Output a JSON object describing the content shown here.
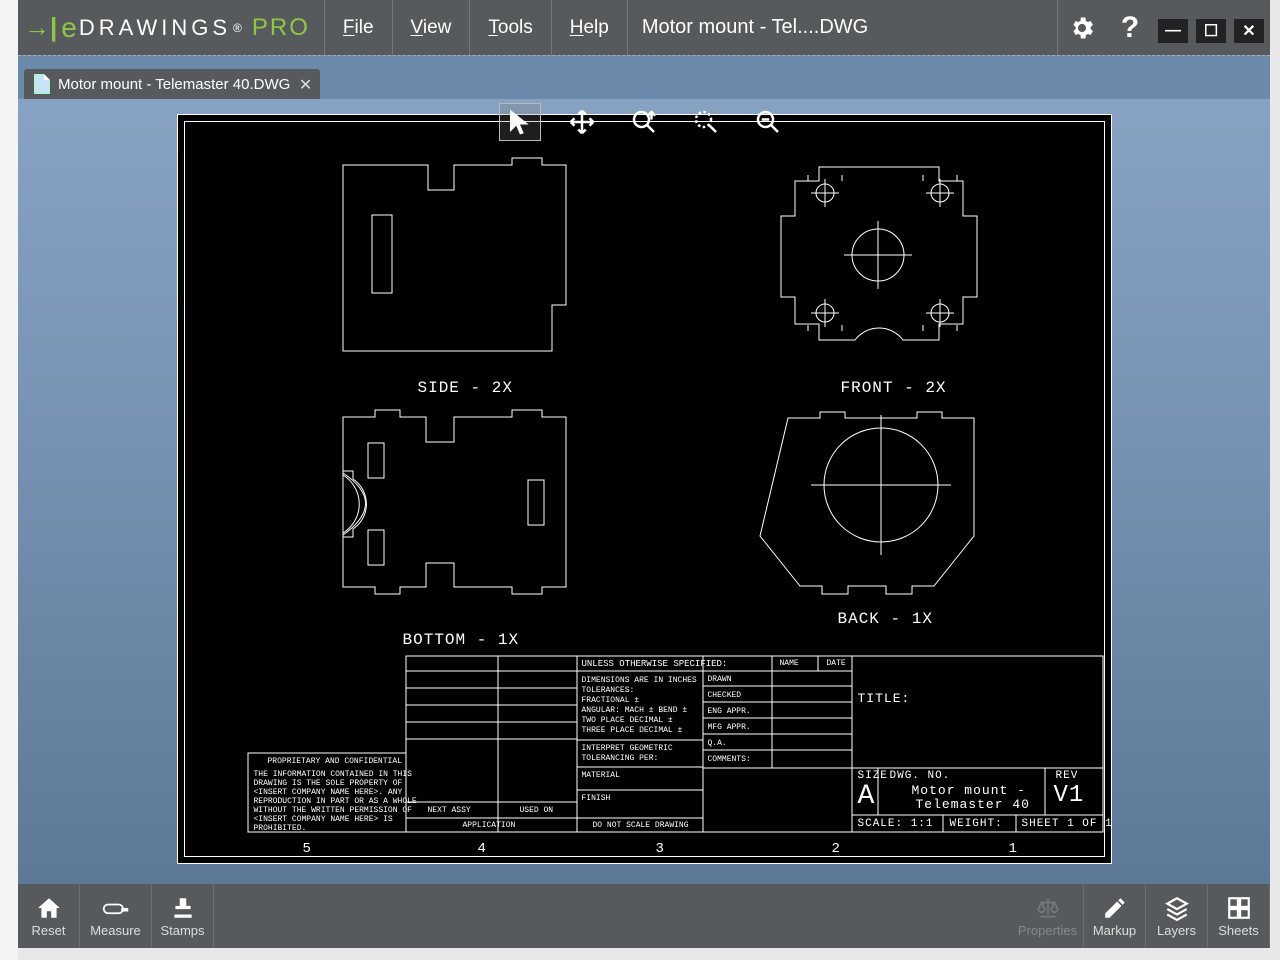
{
  "app": {
    "logo_text": "DRAWINGS",
    "logo_suffix": "PRO",
    "title": "Motor mount - Tel....DWG"
  },
  "menus": {
    "file": "File",
    "view": "View",
    "tools": "Tools",
    "help": "Help"
  },
  "tab": {
    "name": "Motor mount - Telemaster 40.DWG"
  },
  "views": {
    "side": "SIDE - 2X",
    "front": "FRONT - 2X",
    "bottom": "BOTTOM - 1X",
    "back": "BACK - 1X"
  },
  "rulers": {
    "r1": "1",
    "r2": "2",
    "r3": "3",
    "r4": "4",
    "r5": "5"
  },
  "titleblock": {
    "spec_header": "UNLESS OTHERWISE SPECIFIED:",
    "spec1": "DIMENSIONS ARE IN INCHES",
    "spec2": "TOLERANCES:",
    "spec3": "FRACTIONAL ±",
    "spec4": "ANGULAR: MACH ±   BEND ±",
    "spec5": "TWO PLACE DECIMAL   ±",
    "spec6": "THREE PLACE DECIMAL ±",
    "spec7": "INTERPRET GEOMETRIC",
    "spec8": "TOLERANCING PER:",
    "spec9": "MATERIAL",
    "spec10": "FINISH",
    "spec11": "DO NOT SCALE DRAWING",
    "col_name": "NAME",
    "col_date": "DATE",
    "row_drawn": "DRAWN",
    "row_checked": "CHECKED",
    "row_eng": "ENG APPR.",
    "row_mfg": "MFG APPR.",
    "row_qa": "Q.A.",
    "row_comments": "COMMENTS:",
    "title_lbl": "TITLE:",
    "size_lbl": "SIZE",
    "size_val": "A",
    "dwgno_lbl": "DWG.  NO.",
    "dwgno_val1": "Motor mount -",
    "dwgno_val2": "Telemaster 40",
    "rev_lbl": "REV",
    "rev_val": "V1",
    "scale": "SCALE: 1:1",
    "weight": "WEIGHT:",
    "sheet": "SHEET 1 OF 1",
    "nextassy": "NEXT ASSY",
    "usedon": "USED ON",
    "application": "APPLICATION",
    "prop1": "PROPRIETARY AND CONFIDENTIAL",
    "prop2": "THE INFORMATION CONTAINED IN THIS",
    "prop3": "DRAWING IS THE SOLE PROPERTY OF",
    "prop4": "<INSERT COMPANY NAME HERE>.  ANY",
    "prop5": "REPRODUCTION IN PART OR AS A WHOLE",
    "prop6": "WITHOUT THE WRITTEN PERMISSION OF",
    "prop7": "<INSERT COMPANY NAME HERE> IS",
    "prop8": "PROHIBITED."
  },
  "bottombar": {
    "reset": "Reset",
    "measure": "Measure",
    "stamps": "Stamps",
    "properties": "Properties",
    "markup": "Markup",
    "layers": "Layers",
    "sheets": "Sheets"
  }
}
